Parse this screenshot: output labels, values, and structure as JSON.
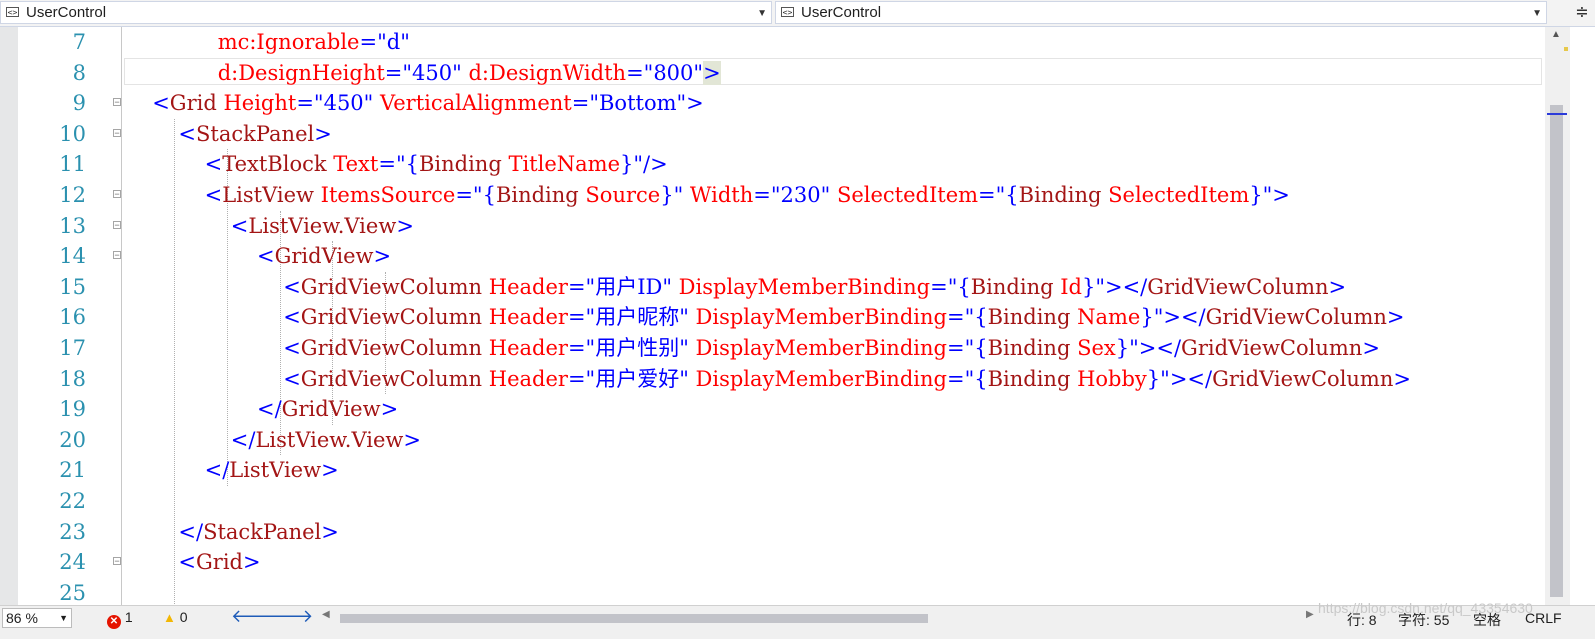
{
  "nav_bar": {
    "left_combo": "UserControl",
    "right_combo": "UserControl",
    "combo_icon": "xaml-element-icon",
    "split_icon": "split-window-icon"
  },
  "colors": {
    "keyword": "#0000ff",
    "element": "#a31515",
    "attribute": "#ff0000",
    "line_number": "#2b91af"
  },
  "lines": [
    {
      "n": "7",
      "fold": false,
      "indent": 7,
      "tokens": [
        {
          "c": "r",
          "t": "mc:Ignorable"
        },
        {
          "c": "b",
          "t": "=\"d\""
        }
      ]
    },
    {
      "n": "8",
      "fold": false,
      "indent": 7,
      "tokens": [
        {
          "c": "r",
          "t": "d:DesignHeight"
        },
        {
          "c": "b",
          "t": "=\"450\" "
        },
        {
          "c": "r",
          "t": "d:DesignWidth"
        },
        {
          "c": "b",
          "t": "=\"800\""
        },
        {
          "c": "b hl",
          "t": ">"
        }
      ]
    },
    {
      "n": "9",
      "fold": true,
      "indent": 2,
      "tokens": [
        {
          "c": "b",
          "t": "<"
        },
        {
          "c": "m",
          "t": "Grid "
        },
        {
          "c": "r",
          "t": "Height"
        },
        {
          "c": "b",
          "t": "=\"450\" "
        },
        {
          "c": "r",
          "t": "VerticalAlignment"
        },
        {
          "c": "b",
          "t": "=\"Bottom\">"
        }
      ]
    },
    {
      "n": "10",
      "fold": true,
      "indent": 4,
      "tokens": [
        {
          "c": "b",
          "t": "<"
        },
        {
          "c": "m",
          "t": "StackPanel"
        },
        {
          "c": "b",
          "t": ">"
        }
      ]
    },
    {
      "n": "11",
      "fold": false,
      "indent": 6,
      "tokens": [
        {
          "c": "b",
          "t": "<"
        },
        {
          "c": "m",
          "t": "TextBlock "
        },
        {
          "c": "r",
          "t": "Text"
        },
        {
          "c": "b",
          "t": "=\"{"
        },
        {
          "c": "m",
          "t": "Binding "
        },
        {
          "c": "r",
          "t": "TitleName"
        },
        {
          "c": "b",
          "t": "}\"/>"
        }
      ]
    },
    {
      "n": "12",
      "fold": true,
      "indent": 6,
      "tokens": [
        {
          "c": "b",
          "t": "<"
        },
        {
          "c": "m",
          "t": "ListView "
        },
        {
          "c": "r",
          "t": "ItemsSource"
        },
        {
          "c": "b",
          "t": "=\"{"
        },
        {
          "c": "m",
          "t": "Binding "
        },
        {
          "c": "r",
          "t": "Source"
        },
        {
          "c": "b",
          "t": "}\" "
        },
        {
          "c": "r",
          "t": "Width"
        },
        {
          "c": "b",
          "t": "=\"230\" "
        },
        {
          "c": "r",
          "t": "SelectedItem"
        },
        {
          "c": "b",
          "t": "=\"{"
        },
        {
          "c": "m",
          "t": "Binding "
        },
        {
          "c": "r",
          "t": "SelectedItem"
        },
        {
          "c": "b",
          "t": "}\">"
        }
      ]
    },
    {
      "n": "13",
      "fold": true,
      "indent": 8,
      "tokens": [
        {
          "c": "b",
          "t": "<"
        },
        {
          "c": "m",
          "t": "ListView.View"
        },
        {
          "c": "b",
          "t": ">"
        }
      ]
    },
    {
      "n": "14",
      "fold": true,
      "indent": 10,
      "tokens": [
        {
          "c": "b",
          "t": "<"
        },
        {
          "c": "m",
          "t": "GridView"
        },
        {
          "c": "b",
          "t": ">"
        }
      ]
    },
    {
      "n": "15",
      "fold": false,
      "indent": 12,
      "tokens": [
        {
          "c": "b",
          "t": "<"
        },
        {
          "c": "m",
          "t": "GridViewColumn "
        },
        {
          "c": "r",
          "t": "Header"
        },
        {
          "c": "b",
          "t": "=\"用户ID\" "
        },
        {
          "c": "r",
          "t": "DisplayMemberBinding"
        },
        {
          "c": "b",
          "t": "=\"{"
        },
        {
          "c": "m",
          "t": "Binding "
        },
        {
          "c": "r",
          "t": "Id"
        },
        {
          "c": "b",
          "t": "}\"></"
        },
        {
          "c": "m",
          "t": "GridViewColumn"
        },
        {
          "c": "b",
          "t": ">"
        }
      ]
    },
    {
      "n": "16",
      "fold": false,
      "indent": 12,
      "tokens": [
        {
          "c": "b",
          "t": "<"
        },
        {
          "c": "m",
          "t": "GridViewColumn "
        },
        {
          "c": "r",
          "t": "Header"
        },
        {
          "c": "b",
          "t": "=\"用户昵称\" "
        },
        {
          "c": "r",
          "t": "DisplayMemberBinding"
        },
        {
          "c": "b",
          "t": "=\"{"
        },
        {
          "c": "m",
          "t": "Binding "
        },
        {
          "c": "r",
          "t": "Name"
        },
        {
          "c": "b",
          "t": "}\"></"
        },
        {
          "c": "m",
          "t": "GridViewColumn"
        },
        {
          "c": "b",
          "t": ">"
        }
      ]
    },
    {
      "n": "17",
      "fold": false,
      "indent": 12,
      "tokens": [
        {
          "c": "b",
          "t": "<"
        },
        {
          "c": "m",
          "t": "GridViewColumn "
        },
        {
          "c": "r",
          "t": "Header"
        },
        {
          "c": "b",
          "t": "=\"用户性别\" "
        },
        {
          "c": "r",
          "t": "DisplayMemberBinding"
        },
        {
          "c": "b",
          "t": "=\"{"
        },
        {
          "c": "m",
          "t": "Binding "
        },
        {
          "c": "r",
          "t": "Sex"
        },
        {
          "c": "b",
          "t": "}\"></"
        },
        {
          "c": "m",
          "t": "GridViewColumn"
        },
        {
          "c": "b",
          "t": ">"
        }
      ]
    },
    {
      "n": "18",
      "fold": false,
      "indent": 12,
      "tokens": [
        {
          "c": "b",
          "t": "<"
        },
        {
          "c": "m",
          "t": "GridViewColumn "
        },
        {
          "c": "r",
          "t": "Header"
        },
        {
          "c": "b",
          "t": "=\"用户爱好\" "
        },
        {
          "c": "r",
          "t": "DisplayMemberBinding"
        },
        {
          "c": "b",
          "t": "=\"{"
        },
        {
          "c": "m",
          "t": "Binding "
        },
        {
          "c": "r",
          "t": "Hobby"
        },
        {
          "c": "b",
          "t": "}\"></"
        },
        {
          "c": "m",
          "t": "GridViewColumn"
        },
        {
          "c": "b",
          "t": ">"
        }
      ]
    },
    {
      "n": "19",
      "fold": false,
      "indent": 10,
      "tokens": [
        {
          "c": "b",
          "t": "</"
        },
        {
          "c": "m",
          "t": "GridView"
        },
        {
          "c": "b",
          "t": ">"
        }
      ]
    },
    {
      "n": "20",
      "fold": false,
      "indent": 8,
      "tokens": [
        {
          "c": "b",
          "t": "</"
        },
        {
          "c": "m",
          "t": "ListView.View"
        },
        {
          "c": "b",
          "t": ">"
        }
      ]
    },
    {
      "n": "21",
      "fold": false,
      "indent": 6,
      "tokens": [
        {
          "c": "b",
          "t": "</"
        },
        {
          "c": "m",
          "t": "ListView"
        },
        {
          "c": "b",
          "t": ">"
        }
      ]
    },
    {
      "n": "22",
      "fold": false,
      "indent": 0,
      "tokens": []
    },
    {
      "n": "23",
      "fold": false,
      "indent": 4,
      "tokens": [
        {
          "c": "b",
          "t": "</"
        },
        {
          "c": "m",
          "t": "StackPanel"
        },
        {
          "c": "b",
          "t": ">"
        }
      ]
    },
    {
      "n": "24",
      "fold": true,
      "indent": 4,
      "tokens": [
        {
          "c": "b",
          "t": "<"
        },
        {
          "c": "m",
          "t": "Grid"
        },
        {
          "c": "b",
          "t": ">"
        }
      ]
    },
    {
      "n": "25",
      "fold": false,
      "indent": 0,
      "tokens": []
    }
  ],
  "status_bar": {
    "zoom": "86 %",
    "errors": "1",
    "warnings": "0",
    "row": "行: 8",
    "col": "字符: 55",
    "whitespace": "空格",
    "eol": "CRLF",
    "watermark": "https://blog.csdn.net/qq_43354630"
  }
}
